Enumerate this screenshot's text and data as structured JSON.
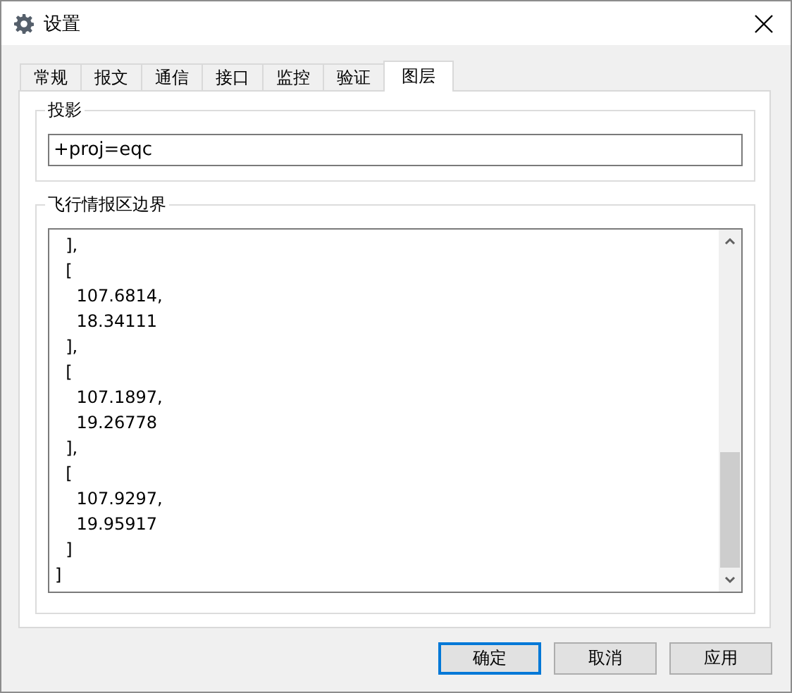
{
  "window": {
    "title": "设置"
  },
  "tabs": [
    {
      "label": "常规",
      "selected": false
    },
    {
      "label": "报文",
      "selected": false
    },
    {
      "label": "通信",
      "selected": false
    },
    {
      "label": "接口",
      "selected": false
    },
    {
      "label": "监控",
      "selected": false
    },
    {
      "label": "验证",
      "selected": false
    },
    {
      "label": "图层",
      "selected": true
    }
  ],
  "projection": {
    "label": "投影",
    "value": "+proj=eqc"
  },
  "fir_boundary": {
    "label": "飞行情报区边界",
    "lines": [
      "  ],",
      "  [",
      "    107.6814,",
      "    18.34111",
      "  ],",
      "  [",
      "    107.1897,",
      "    19.26778",
      "  ],",
      "  [",
      "    107.9297,",
      "    19.95917",
      "  ]",
      "]"
    ]
  },
  "buttons": [
    {
      "label": "确定",
      "default": true
    },
    {
      "label": "取消",
      "default": false
    },
    {
      "label": "应用",
      "default": false
    }
  ]
}
